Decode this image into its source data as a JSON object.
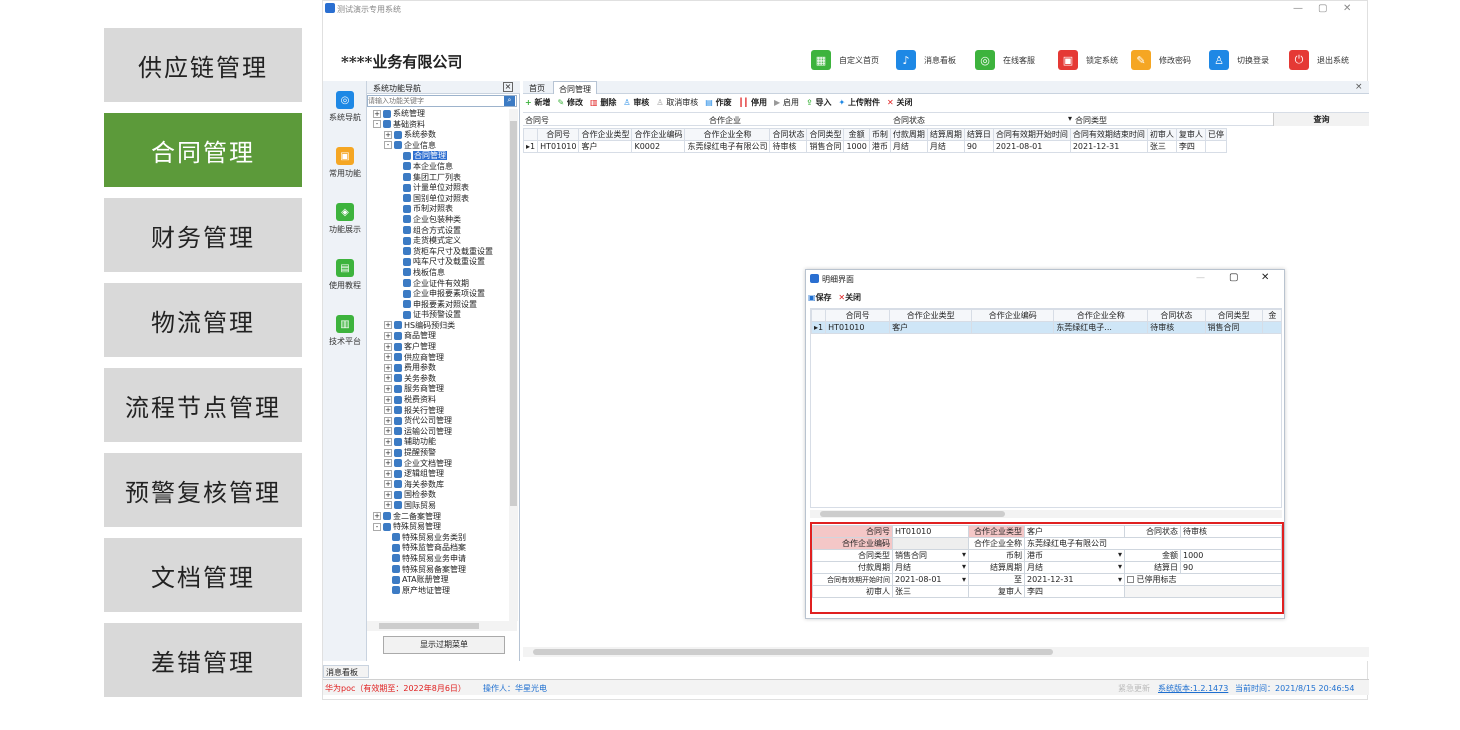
{
  "left_menu": [
    "供应链管理",
    "合同管理",
    "财务管理",
    "物流管理",
    "流程节点管理",
    "预警复核管理",
    "文档管理",
    "差错管理"
  ],
  "colors": {
    "active_menu": "#5c9a3a",
    "menu_bg": "#d9d9d9",
    "highlight_border": "#e02020"
  },
  "window": {
    "title": "测试演示专用系统",
    "company": "****业务有限公司",
    "controls": [
      "—",
      "▢",
      "✕"
    ]
  },
  "top_buttons": [
    {
      "label": "自定义首页",
      "icon": "grid-icon",
      "color": "#3db33d"
    },
    {
      "label": "消息看板",
      "icon": "bell-icon",
      "color": "#1e88e5"
    },
    {
      "label": "在线客服",
      "icon": "headset-icon",
      "color": "#3db33d"
    },
    {
      "label": "锁定系统",
      "icon": "lock-icon",
      "color": "#e53935"
    },
    {
      "label": "修改密码",
      "icon": "edit-icon",
      "color": "#f5a623"
    },
    {
      "label": "切换登录",
      "icon": "user-switch-icon",
      "color": "#1e88e5"
    },
    {
      "label": "退出系统",
      "icon": "power-icon",
      "color": "#e53935"
    }
  ],
  "iconbar": [
    "系统导航",
    "常用功能",
    "功能展示",
    "使用教程",
    "技术平台"
  ],
  "nav": {
    "title": "系统功能导航",
    "search_placeholder": "请输入功能关键字",
    "tree": [
      {
        "t": "系统管理",
        "l": 0,
        "e": "+"
      },
      {
        "t": "基础资料",
        "l": 0,
        "e": "-"
      },
      {
        "t": "系统参数",
        "l": 1,
        "e": "+"
      },
      {
        "t": "企业信息",
        "l": 1,
        "e": "-"
      },
      {
        "t": "合同管理",
        "l": 2,
        "sel": true
      },
      {
        "t": "本企业信息",
        "l": 2
      },
      {
        "t": "集团工厂列表",
        "l": 2
      },
      {
        "t": "计量单位对照表",
        "l": 2
      },
      {
        "t": "国别单位对照表",
        "l": 2
      },
      {
        "t": "币制对照表",
        "l": 2
      },
      {
        "t": "企业包装种类",
        "l": 2
      },
      {
        "t": "组合方式设置",
        "l": 2
      },
      {
        "t": "走货模式定义",
        "l": 2
      },
      {
        "t": "货柜车尺寸及载重设置",
        "l": 2
      },
      {
        "t": "吨车尺寸及载重设置",
        "l": 2
      },
      {
        "t": "栈板信息",
        "l": 2
      },
      {
        "t": "企业证件有效期",
        "l": 2
      },
      {
        "t": "企业申报要素项设置",
        "l": 2
      },
      {
        "t": "申报要素对照设置",
        "l": 2
      },
      {
        "t": "证书预警设置",
        "l": 2
      },
      {
        "t": "HS编码预归类",
        "l": 1,
        "e": "+"
      },
      {
        "t": "商品管理",
        "l": 1,
        "e": "+"
      },
      {
        "t": "客户管理",
        "l": 1,
        "e": "+"
      },
      {
        "t": "供应商管理",
        "l": 1,
        "e": "+"
      },
      {
        "t": "费用参数",
        "l": 1,
        "e": "+"
      },
      {
        "t": "关务参数",
        "l": 1,
        "e": "+"
      },
      {
        "t": "服务商管理",
        "l": 1,
        "e": "+"
      },
      {
        "t": "税费资料",
        "l": 1,
        "e": "+"
      },
      {
        "t": "报关行管理",
        "l": 1,
        "e": "+"
      },
      {
        "t": "货代公司管理",
        "l": 1,
        "e": "+"
      },
      {
        "t": "运输公司管理",
        "l": 1,
        "e": "+"
      },
      {
        "t": "辅助功能",
        "l": 1,
        "e": "+"
      },
      {
        "t": "提醒预警",
        "l": 1,
        "e": "+"
      },
      {
        "t": "企业文档管理",
        "l": 1,
        "e": "+"
      },
      {
        "t": "逻辑组管理",
        "l": 1,
        "e": "+"
      },
      {
        "t": "海关参数库",
        "l": 1,
        "e": "+"
      },
      {
        "t": "国检参数",
        "l": 1,
        "e": "+"
      },
      {
        "t": "国际贸易",
        "l": 1,
        "e": "+"
      },
      {
        "t": "金二备案管理",
        "l": 0,
        "e": "+"
      },
      {
        "t": "特殊贸易管理",
        "l": 0,
        "e": "-"
      },
      {
        "t": "特殊贸易业务类别",
        "l": 1
      },
      {
        "t": "特殊监管商品档案",
        "l": 1
      },
      {
        "t": "特殊贸易业务申请",
        "l": 1
      },
      {
        "t": "特殊贸易备案管理",
        "l": 1
      },
      {
        "t": "ATA账册管理",
        "l": 1
      },
      {
        "t": "原产地证管理",
        "l": 1
      }
    ],
    "footer_button": "显示过期菜单"
  },
  "tabs": [
    "首页",
    "合同管理"
  ],
  "toolbar": [
    "新增",
    "修改",
    "删除",
    "审核",
    "取消审核",
    "作废",
    "停用",
    "启用",
    "导入",
    "上传附件",
    "关闭"
  ],
  "filters": {
    "contract_no": "合同号",
    "partner": "合作企业",
    "status": "合同状态",
    "type": "合同类型",
    "query": "查询"
  },
  "grid": {
    "headers": [
      "合同号",
      "合作企业类型",
      "合作企业编码",
      "合作企业全称",
      "合同状态",
      "合同类型",
      "金额",
      "币制",
      "付款周期",
      "结算周期",
      "结算日",
      "合同有效期开始时间",
      "合同有效期结束时间",
      "初审人",
      "复审人",
      "已停"
    ],
    "rows": [
      [
        "HT01010",
        "客户",
        "K0002",
        "东莞绿红电子有限公司",
        "待审核",
        "销售合同",
        "1000",
        "港币",
        "月结",
        "月结",
        "90",
        "2021-08-01",
        "2021-12-31",
        "张三",
        "李四",
        ""
      ]
    ]
  },
  "dialog": {
    "title": "明细界面",
    "buttons": [
      "保存",
      "关闭"
    ],
    "headers": [
      "合同号",
      "合作企业类型",
      "合作企业编码",
      "合作企业全称",
      "合同状态",
      "合同类型",
      "金"
    ],
    "row": [
      "HT01010",
      "客户",
      "",
      "东莞绿红电子...",
      "待审核",
      "销售合同",
      ""
    ],
    "form": {
      "contract_no_label": "合同号",
      "contract_no": "HT01010",
      "partner_type_label": "合作企业类型",
      "partner_type": "客户",
      "status_label": "合同状态",
      "status": "待审核",
      "partner_code_label": "合作企业编码",
      "partner_code": "",
      "partner_name_label": "合作企业全称",
      "partner_name": "东莞绿红电子有限公司",
      "type_label": "合同类型",
      "type": "销售合同",
      "currency_label": "币制",
      "currency": "港币",
      "amount_label": "金额",
      "amount": "1000",
      "pay_label": "付款周期",
      "pay": "月结",
      "settle_label": "结算周期",
      "settle": "月结",
      "day_label": "结算日",
      "day": "90",
      "start_label": "合同有效期开始时间",
      "start": "2021-08-01",
      "to_label": "至",
      "end": "2021-12-31",
      "stop_label": "已停用标志",
      "first_label": "初审人",
      "first": "张三",
      "second_label": "复审人",
      "second": "李四"
    }
  },
  "bottom": {
    "msg": "消息看板",
    "left": "华为poc（有效期至：2022年8月6日）",
    "operator": "操作人：华星光电",
    "right_grey": "紧急更新",
    "version": "系统版本:1.2.1473",
    "time": "当前时间：2021/8/15 20:46:54"
  }
}
